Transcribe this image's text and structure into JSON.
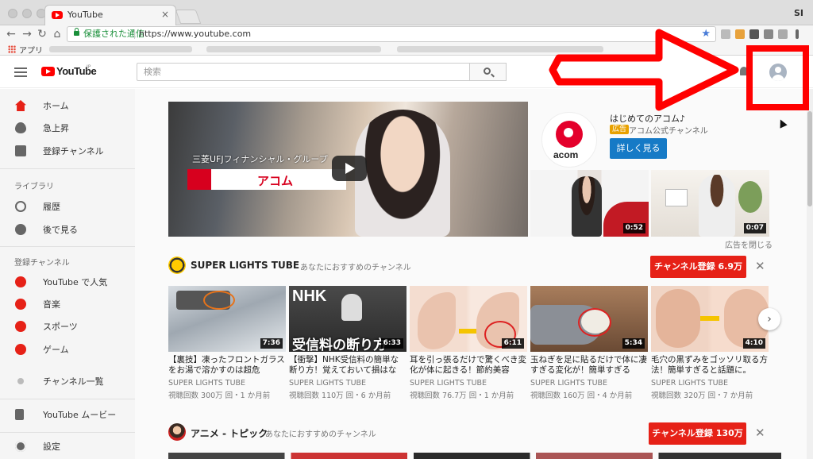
{
  "browser": {
    "tab_title": "YouTube",
    "tab_close": "×",
    "profile_initials": "SI",
    "secure_label": "保護された通信",
    "url": "https://www.youtube.com",
    "bookmark_apps": "アプリ",
    "nav": {
      "back": "←",
      "forward": "→",
      "reload": "↻",
      "home": "⌂"
    },
    "star": "★"
  },
  "masthead": {
    "logo_text": "YouTube",
    "logo_region": "JP",
    "search_placeholder": "検索"
  },
  "sidebar": {
    "primary": [
      {
        "label": "ホーム",
        "icon": "home-icon"
      },
      {
        "label": "急上昇",
        "icon": "flame-icon"
      },
      {
        "label": "登録チャンネル",
        "icon": "subscriptions-icon"
      }
    ],
    "library_heading": "ライブラリ",
    "library": [
      {
        "label": "履歴",
        "icon": "history-icon"
      },
      {
        "label": "後で見る",
        "icon": "clock-icon"
      }
    ],
    "subs_heading": "登録チャンネル",
    "subs": [
      {
        "label": "YouTube で人気",
        "icon": "star-icon"
      },
      {
        "label": "音楽",
        "icon": "music-icon"
      },
      {
        "label": "スポーツ",
        "icon": "sports-icon"
      },
      {
        "label": "ゲーム",
        "icon": "game-icon"
      }
    ],
    "browse_channels": "チャンネル一覧",
    "movies": "YouTube ムービー",
    "settings": "設定"
  },
  "ad": {
    "banner_sub": "三菱UFJフィナンシャル・グループ",
    "banner_text": "アコム",
    "logo_word": "acom",
    "title": "はじめてのアコム♪",
    "badge": "広告",
    "channel": "アコム公式チャンネル",
    "learn_more": "詳しく見る",
    "side_durations": [
      "0:52",
      "0:07"
    ],
    "close": "広告を閉じる"
  },
  "shelf1": {
    "channel": "SUPER LIGHTS TUBE",
    "subtitle": "あなたにおすすめのチャンネル",
    "subscribe": "チャンネル登録  6.9万",
    "dismiss": "✕",
    "next": "›",
    "videos": [
      {
        "title": "【裏技】凍ったフロントガラスをお湯で溶かすのは超危",
        "channel": "SUPER LIGHTS TUBE",
        "meta": "視聴回数 300万 回・1 か月前",
        "duration": "7:36"
      },
      {
        "title": "【衝撃】NHK受信料の簡単な断り方！覚えておいて損はな",
        "channel": "SUPER LIGHTS TUBE",
        "meta": "視聴回数 110万 回・6 か月前",
        "duration": "6:33"
      },
      {
        "title": "耳を引っ張るだけで驚くべき変化が体に起きる！節約美容",
        "channel": "SUPER LIGHTS TUBE",
        "meta": "視聴回数 76.7万 回・1 か月前",
        "duration": "6:11"
      },
      {
        "title": "玉ねぎを足に貼るだけで体に凄すぎる変化が！簡単すぎる",
        "channel": "SUPER LIGHTS TUBE",
        "meta": "視聴回数 160万 回・4 か月前",
        "duration": "5:34"
      },
      {
        "title": "毛穴の黒ずみをゴッソリ取る方法！簡単すぎると話題に。",
        "channel": "SUPER LIGHTS TUBE",
        "meta": "視聴回数 320万 回・7 か月前",
        "duration": "4:10"
      }
    ],
    "thumb2_nhk": "NHK",
    "thumb2_caption": "受信料の断り方"
  },
  "shelf2": {
    "channel": "アニメ - トピック",
    "subtitle": "あなたにおすすめのチャンネル",
    "subscribe": "チャンネル登録  130万",
    "dismiss": "✕"
  }
}
